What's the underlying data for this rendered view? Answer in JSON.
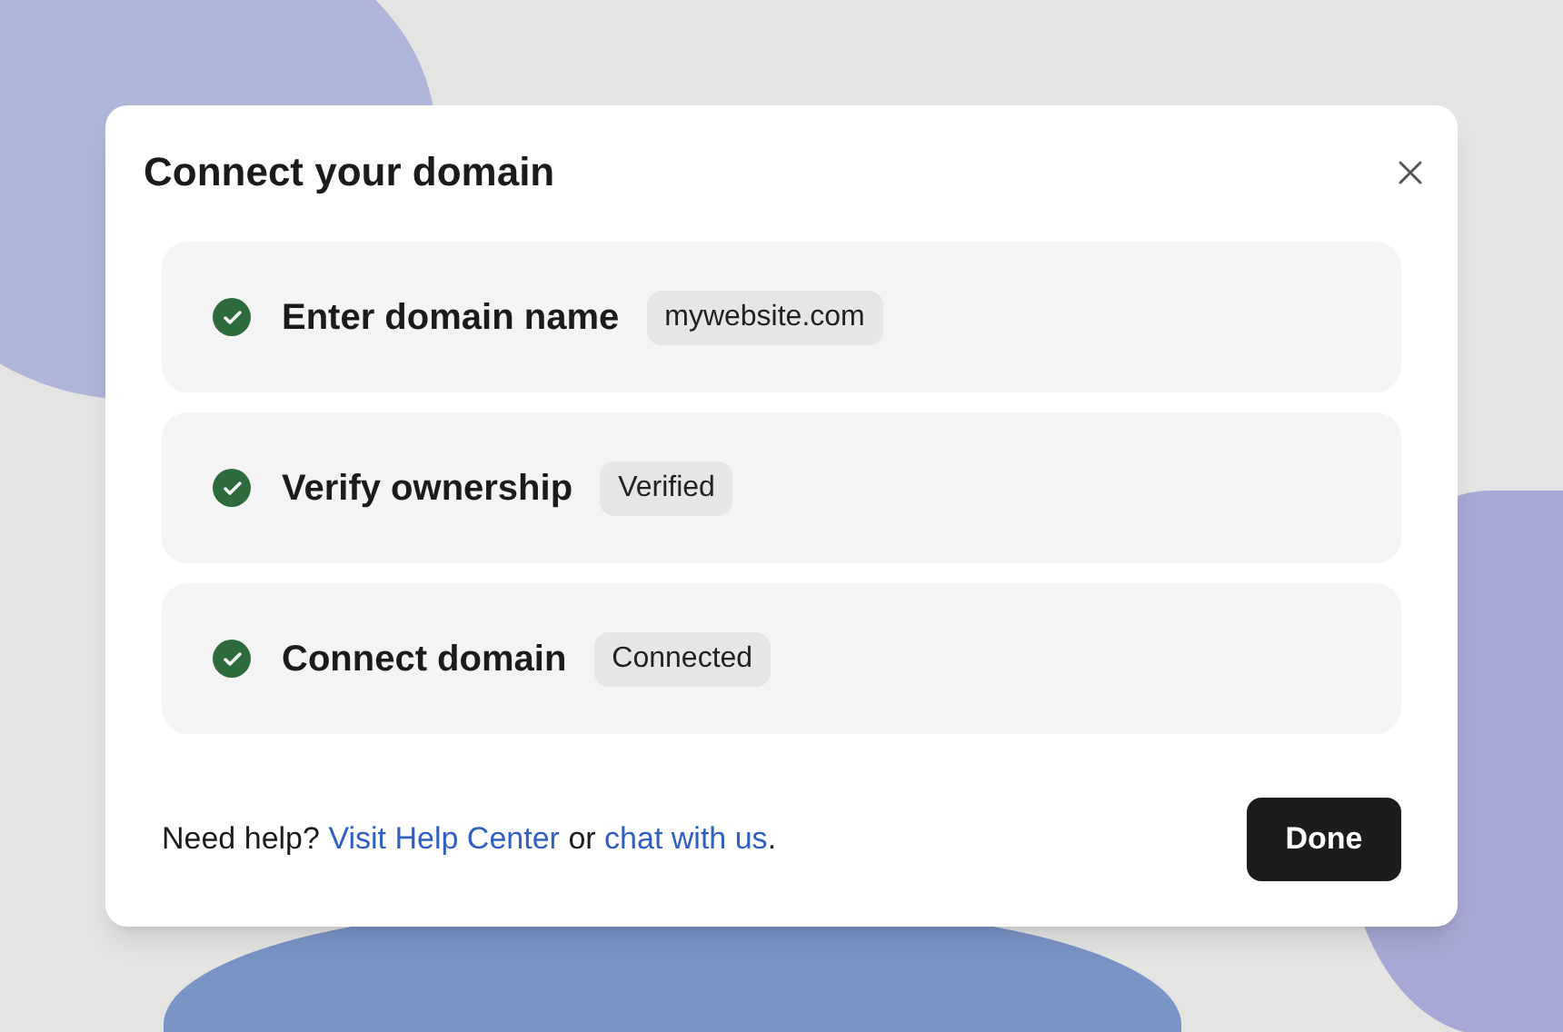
{
  "dialog": {
    "title": "Connect your domain",
    "steps": [
      {
        "label": "Enter domain name",
        "tag": "mywebsite.com",
        "completed": true
      },
      {
        "label": "Verify ownership",
        "tag": "Verified",
        "completed": true
      },
      {
        "label": "Connect domain",
        "tag": "Connected",
        "completed": true
      }
    ],
    "footer": {
      "prefix": "Need help?",
      "help_link": "Visit Help Center",
      "middle": "or",
      "chat_link": "chat with us",
      "suffix": "."
    },
    "done_button": "Done"
  }
}
